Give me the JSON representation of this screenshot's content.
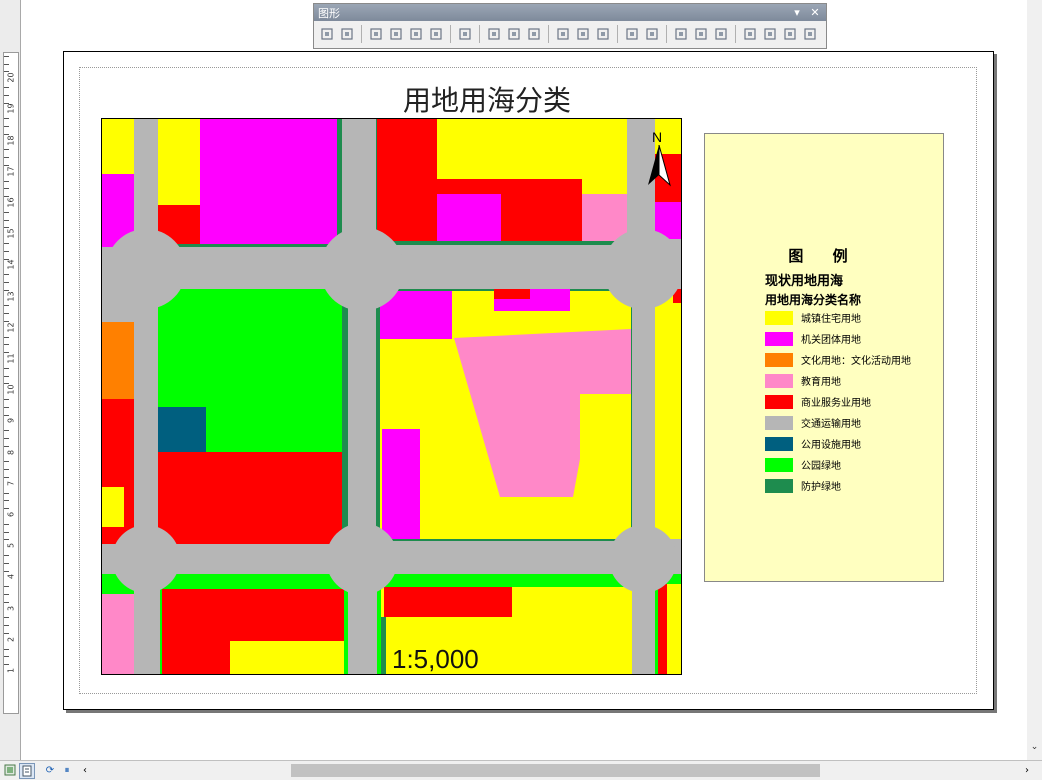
{
  "toolbar": {
    "title": "图形",
    "menu_glyph": "▾",
    "close_glyph": "✕",
    "buttons": [
      "group-icon",
      "ungroup-icon",
      "bring-to-front-icon",
      "send-to-back-icon",
      "bring-forward-icon",
      "send-backward-icon",
      "align-left-edge-icon",
      "align-left-icon",
      "align-center-icon",
      "align-right-icon",
      "align-top-icon",
      "align-middle-icon",
      "align-bottom-icon",
      "distribute-horizontal-icon",
      "distribute-vertical-icon",
      "make-same-size-icon",
      "make-same-width-icon",
      "make-same-height-icon",
      "rotate-left-icon",
      "rotate-right-icon",
      "flip-horizontal-icon",
      "flip-vertical-icon"
    ]
  },
  "ruler": {
    "labels": [
      "1",
      "2",
      "3",
      "4",
      "5",
      "6",
      "7",
      "8",
      "9",
      "10",
      "11",
      "12",
      "13",
      "14",
      "15",
      "16",
      "17",
      "18",
      "19",
      "20"
    ]
  },
  "layout": {
    "title": "用地用海分类",
    "north_label": "N",
    "scale_text": "1:5,000"
  },
  "legend": {
    "title": "图 例",
    "layer_name": "现状用地用海",
    "field_name": "用地用海分类名称",
    "items": [
      {
        "label": "城镇住宅用地",
        "color": "#ffff00"
      },
      {
        "label": "机关团体用地",
        "color": "#ff00ff"
      },
      {
        "label": "文化用地：文化活动用地",
        "color": "#ff8000"
      },
      {
        "label": "教育用地",
        "color": "#ff88c8"
      },
      {
        "label": "商业服务业用地",
        "color": "#ff0000"
      },
      {
        "label": "交通运输用地",
        "color": "#b6b6b6"
      },
      {
        "label": "公用设施用地",
        "color": "#005f7f"
      },
      {
        "label": "公园绿地",
        "color": "#00ff00"
      },
      {
        "label": "防护绿地",
        "color": "#1e8c4e"
      }
    ]
  },
  "status": {
    "view_buttons": [
      "data-view-icon",
      "layout-view-icon",
      "refresh-icon",
      "pause-icon"
    ],
    "scroll_left": "‹",
    "scroll_right": "›",
    "scroll_down": "⌄"
  }
}
